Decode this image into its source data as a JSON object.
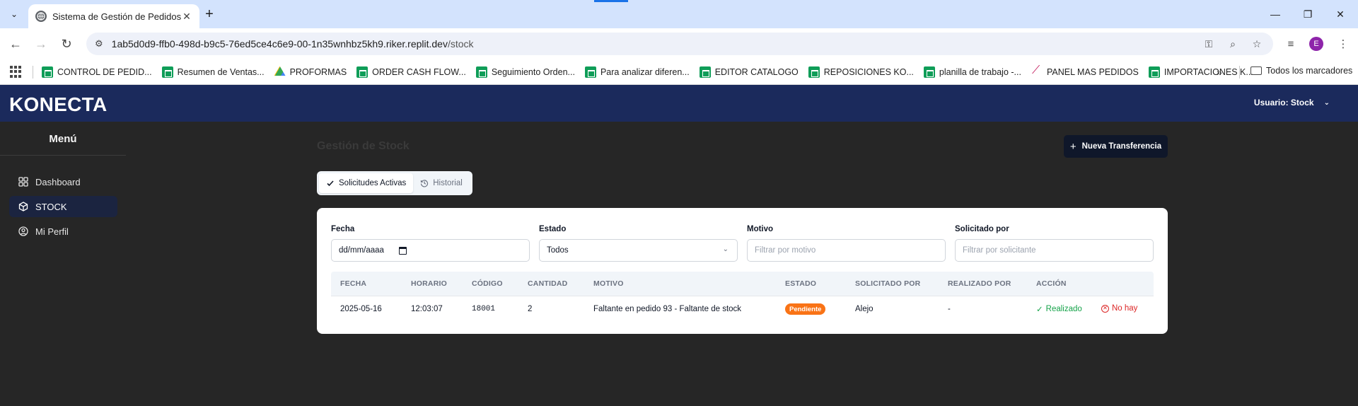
{
  "browser": {
    "tab_title": "Sistema de Gestión de Pedidos",
    "url_host": "1ab5d0d9-ffb0-498d-b9c5-76ed5ce4c6e9-00-1n35wnhbz5kh9.riker.replit.dev",
    "url_path": "/stock",
    "profile_initial": "E",
    "bookmarks": [
      {
        "label": "CONTROL DE PEDID...",
        "icon": "sheet"
      },
      {
        "label": "Resumen de Ventas...",
        "icon": "sheet"
      },
      {
        "label": "PROFORMAS",
        "icon": "drive"
      },
      {
        "label": "ORDER CASH FLOW...",
        "icon": "sheet"
      },
      {
        "label": "Seguimiento Orden...",
        "icon": "sheet"
      },
      {
        "label": "Para analizar diferen...",
        "icon": "sheet"
      },
      {
        "label": "EDITOR CATALOGO",
        "icon": "sheet"
      },
      {
        "label": "REPOSICIONES KO...",
        "icon": "sheet"
      },
      {
        "label": "planilla de trabajo -...",
        "icon": "sheet"
      },
      {
        "label": "PANEL MAS PEDIDOS",
        "icon": "panel"
      },
      {
        "label": "IMPORTACIONES K...",
        "icon": "sheet"
      }
    ],
    "more_bookmarks": "»",
    "all_bookmarks": "Todos los marcadores"
  },
  "app": {
    "logo": "KONECTA",
    "user_label": "Usuario: Stock"
  },
  "sidebar": {
    "title": "Menú",
    "items": [
      {
        "label": "Dashboard",
        "icon": "grid-icon",
        "active": false
      },
      {
        "label": "STOCK",
        "icon": "box-icon",
        "active": true
      },
      {
        "label": "Mi Perfil",
        "icon": "user-circle-icon",
        "active": false
      }
    ]
  },
  "main": {
    "title": "Gestión de Stock",
    "new_button": "Nueva Transferencia",
    "tabs": [
      {
        "label": "Solicitudes Activas",
        "icon": "check-icon",
        "active": true
      },
      {
        "label": "Historial",
        "icon": "history-icon",
        "active": false
      }
    ],
    "filters": {
      "fecha": {
        "label": "Fecha",
        "value": "dd/mm/aaaa"
      },
      "estado": {
        "label": "Estado",
        "value": "Todos"
      },
      "motivo": {
        "label": "Motivo",
        "placeholder": "Filtrar por motivo"
      },
      "solicitado": {
        "label": "Solicitado por",
        "placeholder": "Filtrar por solicitante"
      }
    },
    "table": {
      "headers": [
        "FECHA",
        "HORARIO",
        "CÓDIGO",
        "CANTIDAD",
        "MOTIVO",
        "ESTADO",
        "SOLICITADO POR",
        "REALIZADO POR",
        "ACCIÓN"
      ],
      "rows": [
        {
          "fecha": "2025-05-16",
          "horario": "12:03:07",
          "codigo": "18001",
          "cantidad": "2",
          "motivo": "Faltante en pedido 93 - Faltante de stock",
          "estado": "Pendiente",
          "solicitado": "Alejo",
          "realizado": "-",
          "accion_ok": "Realizado",
          "accion_no": "No hay"
        }
      ]
    }
  },
  "colors": {
    "header_bg": "#1b2a5c",
    "page_bg": "#262626",
    "primary_button": "#0f172a",
    "status_pending": "#f97316",
    "action_ok": "#16a34a",
    "action_no": "#dc2626"
  }
}
